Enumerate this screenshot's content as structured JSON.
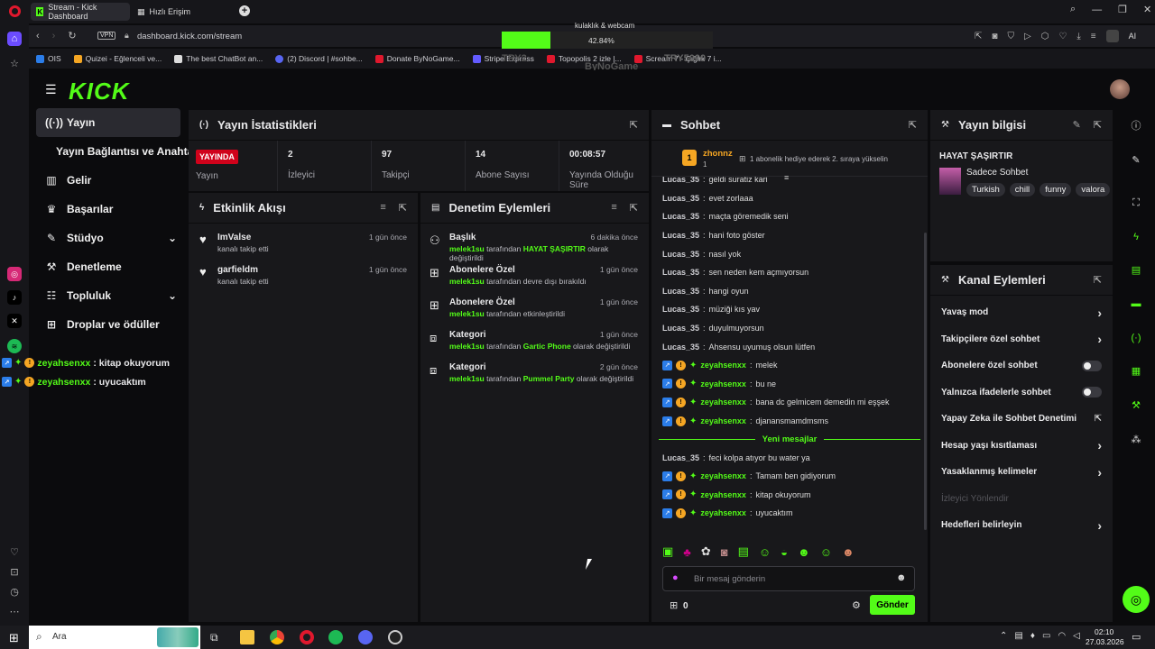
{
  "browser": {
    "tabs": [
      {
        "label": "Stream - Kick Dashboard"
      },
      {
        "label": "Hızlı Erişim"
      }
    ],
    "url": "dashboard.kick.com/stream",
    "vpn": "VPN",
    "ai_label": "AI",
    "bookmarks": [
      "OIS",
      "Quizei - Eğlenceli ve...",
      "The best ChatBot an...",
      "(2) Discord | #sohbe...",
      "Donate ByNoGame...",
      "Stripe Express",
      "Topopolis 2 izle |...",
      "Scream 7 - Çığlık 7 i..."
    ]
  },
  "overlay": {
    "title": "kulaklık & webcam",
    "progress_text": "42.84%",
    "progress_value": 42.84,
    "ghost1": "TRY2",
    "ghost2": "TRY5000",
    "ghost3": "ByNoGame"
  },
  "sidebar": {
    "items": [
      {
        "label": "Yayın",
        "icon": "broadcast-icon"
      },
      {
        "label": "Yayın Bağlantısı ve Anahtarı",
        "icon": ""
      },
      {
        "label": "Gelir",
        "icon": "chart-icon"
      },
      {
        "label": "Başarılar",
        "icon": "trophy-icon"
      },
      {
        "label": "Stüdyo",
        "icon": "brush-icon"
      },
      {
        "label": "Denetleme",
        "icon": "wrench-icon"
      },
      {
        "label": "Topluluk",
        "icon": "community-icon"
      },
      {
        "label": "Droplar ve ödüller",
        "icon": "gift-icon"
      }
    ],
    "chat_overlay": [
      {
        "user": "zeyahsenxx",
        "text": ": kitap okuyorum"
      },
      {
        "user": "zeyahsenxx",
        "text": ": uyucaktım"
      }
    ]
  },
  "stats": {
    "title": "Yayın İstatistikleri",
    "live_badge": "YAYINDA",
    "live_label": "Yayın",
    "items": [
      {
        "value": "2",
        "label": "İzleyici"
      },
      {
        "value": "97",
        "label": "Takipçi"
      },
      {
        "value": "14",
        "label": "Abone Sayısı"
      },
      {
        "value": "00:08:57",
        "label": "Yayında Olduğu Süre"
      }
    ]
  },
  "activity": {
    "title": "Etkinlik Akışı",
    "items": [
      {
        "name": "ImValse",
        "sub": "kanalı takip etti",
        "date": "1 gün önce"
      },
      {
        "name": "garfieldm",
        "sub": "kanalı takip etti",
        "date": "1 gün önce"
      }
    ]
  },
  "moderation": {
    "title": "Denetim Eylemleri",
    "items": [
      {
        "title": "Başlık",
        "date": "6 dakika önce",
        "user": "melek1su",
        "mid": " tarafından ",
        "hl": "HAYAT ŞAŞIRTIR",
        "end": " olarak değiştirildi"
      },
      {
        "title": "Abonelere Özel",
        "date": "1 gün önce",
        "user": "melek1su",
        "mid": " tarafından devre dışı bırakıldı",
        "hl": "",
        "end": ""
      },
      {
        "title": "Abonelere Özel",
        "date": "1 gün önce",
        "user": "melek1su",
        "mid": " tarafından etkinleştirildi",
        "hl": "",
        "end": ""
      },
      {
        "title": "Kategori",
        "date": "1 gün önce",
        "user": "melek1su",
        "mid": " tarafından ",
        "hl": "Gartic Phone",
        "end": " olarak değiştirildi"
      },
      {
        "title": "Kategori",
        "date": "2 gün önce",
        "user": "melek1su",
        "mid": " tarafından ",
        "hl": "Pummel Party",
        "end": " olarak değiştirildi"
      }
    ]
  },
  "chat": {
    "title": "Sohbet",
    "pinned_user": "zhonnz",
    "pinned_count": "1",
    "pinned_text": "1 abonelik hediye ederek 2. sıraya yükselin",
    "lines": [
      {
        "user": "Lucas_35",
        "text": " geldi suratiz kari",
        "badges": false
      },
      {
        "user": "Lucas_35",
        "text": " evet zorlaaa",
        "badges": false
      },
      {
        "user": "Lucas_35",
        "text": " maçta göremedik seni",
        "badges": false
      },
      {
        "user": "Lucas_35",
        "text": " hani foto göster",
        "badges": false
      },
      {
        "user": "Lucas_35",
        "text": " nasıl yok",
        "badges": false
      },
      {
        "user": "Lucas_35",
        "text": " sen neden kem açmıyorsun",
        "badges": false
      },
      {
        "user": "Lucas_35",
        "text": " hangi oyun",
        "badges": false
      },
      {
        "user": "Lucas_35",
        "text": " müziği kıs yav",
        "badges": false
      },
      {
        "user": "Lucas_35",
        "text": " duyulmuyorsun",
        "badges": false
      },
      {
        "user": "Lucas_35",
        "text": " Ahsensu uyumuş olsun lütfen",
        "badges": false
      },
      {
        "user": "zeyahsenxx",
        "text": " melek",
        "badges": true
      },
      {
        "user": "zeyahsenxx",
        "text": " bu ne",
        "badges": true
      },
      {
        "user": "zeyahsenxx",
        "text": " bana dc gelmicem demedin mi eşşek",
        "badges": true
      },
      {
        "user": "zeyahsenxx",
        "text": " djanansmamdmsms",
        "badges": true
      }
    ],
    "new_messages": "Yeni mesajlar",
    "new_lines": [
      {
        "user": "Lucas_35",
        "text": " feci kolpa atıyor bu water ya",
        "badges": false
      },
      {
        "user": "zeyahsenxx",
        "text": " Tamam ben gidiyorum",
        "badges": true
      },
      {
        "user": "zeyahsenxx",
        "text": " kitap okuyorum",
        "badges": true
      },
      {
        "user": "zeyahsenxx",
        "text": " uyucaktım",
        "badges": true
      }
    ],
    "input_placeholder": "Bir mesaj gönderin",
    "points": "0",
    "send_label": "Gönder"
  },
  "stream_info": {
    "title": "Yayın bilgisi",
    "stream_title": "HAYAT ŞAŞIRTIR",
    "category": "Sadece Sohbet",
    "tags": [
      "Turkish",
      "chill",
      "funny",
      "valora"
    ]
  },
  "channel_actions": {
    "title": "Kanal Eylemleri",
    "rows": [
      {
        "label": "Yavaş mod",
        "control": "chevron"
      },
      {
        "label": "Takipçilere özel sohbet",
        "control": "chevron"
      },
      {
        "label": "Abonelere özel sohbet",
        "control": "toggle"
      },
      {
        "label": "Yalnızca ifadelerle sohbet",
        "control": "toggle"
      },
      {
        "label": "Yapay Zeka ile Sohbet Denetimi",
        "control": "external"
      },
      {
        "label": "Hesap yaşı kısıtlaması",
        "control": "chevron"
      },
      {
        "label": "Yasaklanmış kelimeler",
        "control": "chevron"
      },
      {
        "label": "İzleyici Yönlendir",
        "control": "disabled"
      },
      {
        "label": "Hedefleri belirleyin",
        "control": "chevron"
      }
    ]
  },
  "taskbar": {
    "search_label": "Ara",
    "time": "02:10",
    "date": "27.03.2026"
  },
  "colors": {
    "accent": "#53fc18",
    "panel": "#18181b",
    "live": "#d0021b"
  }
}
